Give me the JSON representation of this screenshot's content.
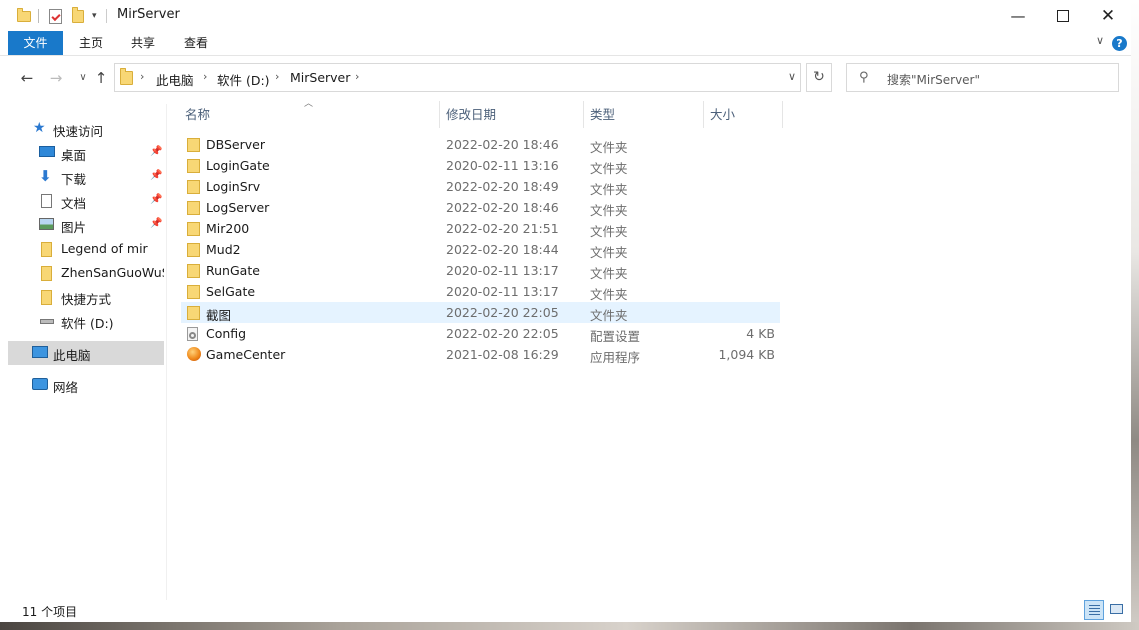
{
  "window": {
    "title": "MirServer"
  },
  "ribbon": {
    "tabs": [
      "文件",
      "主页",
      "共享",
      "查看"
    ],
    "help": "?"
  },
  "address": {
    "crumbs": [
      "此电脑",
      "软件 (D:)",
      "MirServer"
    ]
  },
  "search": {
    "placeholder": "搜索\"MirServer\""
  },
  "sidebar": {
    "items": [
      {
        "label": "快速访问",
        "icon": "star-icon",
        "pinned": false
      },
      {
        "label": "桌面",
        "icon": "desktop-icon",
        "pinned": true
      },
      {
        "label": "下载",
        "icon": "download-icon",
        "pinned": true
      },
      {
        "label": "文档",
        "icon": "document-icon",
        "pinned": true
      },
      {
        "label": "图片",
        "icon": "picture-icon",
        "pinned": true
      },
      {
        "label": "Legend of mir",
        "icon": "folder-icon",
        "pinned": false
      },
      {
        "label": "ZhenSanGuoWuSh",
        "icon": "folder-icon",
        "pinned": false
      },
      {
        "label": "快捷方式",
        "icon": "folder-icon",
        "pinned": false
      },
      {
        "label": "软件 (D:)",
        "icon": "drive-icon",
        "pinned": false
      },
      {
        "label": "此电脑",
        "icon": "computer-icon",
        "pinned": false,
        "selected": true
      },
      {
        "label": "网络",
        "icon": "network-icon",
        "pinned": false
      }
    ]
  },
  "columns": {
    "name": "名称",
    "date": "修改日期",
    "type": "类型",
    "size": "大小"
  },
  "files": [
    {
      "name": "DBServer",
      "date": "2022-02-20 18:46",
      "type": "文件夹",
      "size": "",
      "icon": "folder-icon"
    },
    {
      "name": "LoginGate",
      "date": "2020-02-11 13:16",
      "type": "文件夹",
      "size": "",
      "icon": "folder-icon"
    },
    {
      "name": "LoginSrv",
      "date": "2022-02-20 18:49",
      "type": "文件夹",
      "size": "",
      "icon": "folder-icon"
    },
    {
      "name": "LogServer",
      "date": "2022-02-20 18:46",
      "type": "文件夹",
      "size": "",
      "icon": "folder-icon"
    },
    {
      "name": "Mir200",
      "date": "2022-02-20 21:51",
      "type": "文件夹",
      "size": "",
      "icon": "folder-icon"
    },
    {
      "name": "Mud2",
      "date": "2022-02-20 18:44",
      "type": "文件夹",
      "size": "",
      "icon": "folder-icon"
    },
    {
      "name": "RunGate",
      "date": "2020-02-11 13:17",
      "type": "文件夹",
      "size": "",
      "icon": "folder-icon"
    },
    {
      "name": "SelGate",
      "date": "2020-02-11 13:17",
      "type": "文件夹",
      "size": "",
      "icon": "folder-icon"
    },
    {
      "name": "截图",
      "date": "2022-02-20 22:05",
      "type": "文件夹",
      "size": "",
      "icon": "folder-icon",
      "highlighted": true
    },
    {
      "name": "Config",
      "date": "2022-02-20 22:05",
      "type": "配置设置",
      "size": "4 KB",
      "icon": "config-file-icon"
    },
    {
      "name": "GameCenter",
      "date": "2021-02-08 16:29",
      "type": "应用程序",
      "size": "1,094 KB",
      "icon": "app-icon"
    }
  ],
  "status": {
    "count": "11 个项目"
  },
  "colors": {
    "accent": "#1979ca",
    "folder": "#f8d775",
    "hover_row": "#e5f3ff",
    "selected_nav": "#d9d9d9"
  }
}
